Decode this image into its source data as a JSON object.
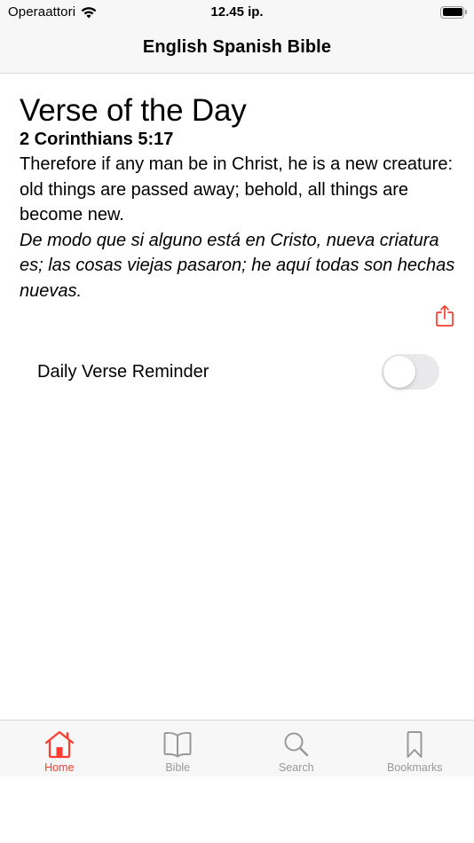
{
  "status_bar": {
    "carrier": "Operaattori",
    "time": "12.45 ip.",
    "wifi_icon": "wifi-icon",
    "battery_icon": "battery-icon",
    "battery_level": 1.0
  },
  "nav": {
    "title": "English Spanish Bible"
  },
  "verse_of_the_day": {
    "heading": "Verse of the Day",
    "reference": "2 Corinthians 5:17",
    "english": "Therefore if any man be in Christ, he is a new creature: old things are passed away; behold, all things are become new.",
    "spanish": " De modo que si alguno está en Cristo, nueva criatura es; las cosas viejas pasaron; he aquí todas son hechas nuevas.",
    "share_icon": "share-icon"
  },
  "settings": {
    "daily_reminder_label": "Daily Verse Reminder",
    "daily_reminder_enabled": false
  },
  "tab_bar": {
    "active_color": "#ff3b30",
    "inactive_color": "#999999",
    "tabs": [
      {
        "label": "Home",
        "icon": "house-icon",
        "active": true
      },
      {
        "label": "Bible",
        "icon": "book-icon",
        "active": false
      },
      {
        "label": "Search",
        "icon": "magnifying-glass-icon",
        "active": false
      },
      {
        "label": "Bookmarks",
        "icon": "bookmark-icon",
        "active": false
      }
    ]
  }
}
